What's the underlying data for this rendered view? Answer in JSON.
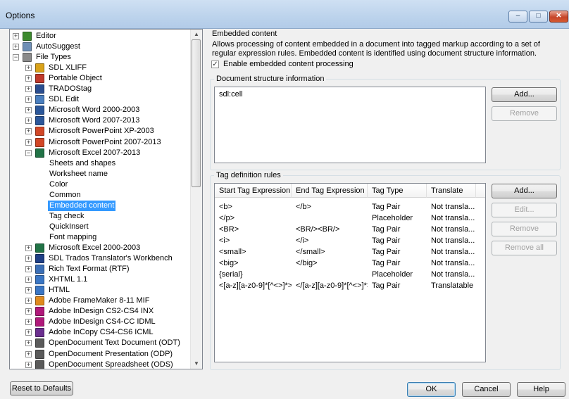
{
  "window": {
    "title": "Options",
    "minimize_glyph": "–",
    "maximize_glyph": "□",
    "close_glyph": "✕"
  },
  "tree": {
    "items": [
      {
        "label": "Editor",
        "icon": "editor-icon",
        "color": "#3c8a2e",
        "expander": "+"
      },
      {
        "label": "AutoSuggest",
        "icon": "autosuggest-icon",
        "color": "#6e8fb5",
        "expander": "+"
      },
      {
        "label": "File Types",
        "icon": "file-types-icon",
        "color": "#8a8a8a",
        "expander": "−"
      },
      {
        "label": "SDL XLIFF",
        "icon": "sdl-xliff-icon",
        "color": "#d9a21a",
        "expander": "+"
      },
      {
        "label": "Portable Object",
        "icon": "portable-object-icon",
        "color": "#c0392b",
        "expander": "+"
      },
      {
        "label": "TRADOStag",
        "icon": "tradostag-icon",
        "color": "#2a4d8f",
        "expander": "+"
      },
      {
        "label": "SDL Edit",
        "icon": "sdl-edit-icon",
        "color": "#4a7fbf",
        "expander": "+"
      },
      {
        "label": "Microsoft Word 2000-2003",
        "icon": "word-icon",
        "color": "#2b579a",
        "expander": "+"
      },
      {
        "label": "Microsoft Word 2007-2013",
        "icon": "word-icon",
        "color": "#2b579a",
        "expander": "+"
      },
      {
        "label": "Microsoft PowerPoint XP-2003",
        "icon": "powerpoint-icon",
        "color": "#d24726",
        "expander": "+"
      },
      {
        "label": "Microsoft PowerPoint 2007-2013",
        "icon": "powerpoint-icon",
        "color": "#d24726",
        "expander": "+"
      },
      {
        "label": "Microsoft Excel 2007-2013",
        "icon": "excel-icon",
        "color": "#217346",
        "expander": "−"
      },
      {
        "label": "Sheets and shapes",
        "icon": "",
        "color": "",
        "expander": ""
      },
      {
        "label": "Worksheet name",
        "icon": "",
        "color": "",
        "expander": ""
      },
      {
        "label": "Color",
        "icon": "",
        "color": "",
        "expander": ""
      },
      {
        "label": "Common",
        "icon": "",
        "color": "",
        "expander": ""
      },
      {
        "label": "Embedded content",
        "icon": "",
        "color": "",
        "expander": ""
      },
      {
        "label": "Tag check",
        "icon": "",
        "color": "",
        "expander": ""
      },
      {
        "label": "QuickInsert",
        "icon": "",
        "color": "",
        "expander": ""
      },
      {
        "label": "Font mapping",
        "icon": "",
        "color": "",
        "expander": ""
      },
      {
        "label": "Microsoft Excel 2000-2003",
        "icon": "excel-icon",
        "color": "#217346",
        "expander": "+"
      },
      {
        "label": "SDL Trados Translator's Workbench",
        "icon": "workbench-icon",
        "color": "#1f3f86",
        "expander": "+"
      },
      {
        "label": "Rich Text Format (RTF)",
        "icon": "rtf-icon",
        "color": "#3b6fb6",
        "expander": "+"
      },
      {
        "label": "XHTML 1.1",
        "icon": "xhtml-icon",
        "color": "#3a76c4",
        "expander": "+"
      },
      {
        "label": "HTML",
        "icon": "html-icon",
        "color": "#3a76c4",
        "expander": "+"
      },
      {
        "label": "Adobe FrameMaker 8-11 MIF",
        "icon": "framemaker-icon",
        "color": "#e08a1e",
        "expander": "+"
      },
      {
        "label": "Adobe InDesign CS2-CS4 INX",
        "icon": "indesign-icon",
        "color": "#b0187a",
        "expander": "+"
      },
      {
        "label": "Adobe InDesign CS4-CC IDML",
        "icon": "indesign-icon",
        "color": "#b0187a",
        "expander": "+"
      },
      {
        "label": "Adobe InCopy CS4-CS6 ICML",
        "icon": "incopy-icon",
        "color": "#6b2f8f",
        "expander": "+"
      },
      {
        "label": "OpenDocument Text Document (ODT)",
        "icon": "odt-icon",
        "color": "#5a5a5a",
        "expander": "+"
      },
      {
        "label": "OpenDocument Presentation (ODP)",
        "icon": "odp-icon",
        "color": "#5a5a5a",
        "expander": "+"
      },
      {
        "label": "OpenDocument Spreadsheet (ODS)",
        "icon": "ods-icon",
        "color": "#5a5a5a",
        "expander": "+"
      }
    ],
    "selected": "Embedded content",
    "scroll_up": "▲",
    "scroll_down": "▼"
  },
  "embedded": {
    "heading": "Embedded content",
    "description": "Allows processing of content embedded in a document into tagged markup according to a set of regular expression rules. Embedded content is identified using document structure information.",
    "enable_label": "Enable embedded content processing",
    "enable_checked": "✓"
  },
  "structure": {
    "title": "Document structure information",
    "items": [
      "sdl:cell"
    ],
    "add_label": "Add...",
    "remove_label": "Remove"
  },
  "rules": {
    "title": "Tag definition rules",
    "columns": [
      "Start Tag Expression",
      "End Tag Expression",
      "Tag Type",
      "Translate"
    ],
    "rows": [
      [
        "<b>",
        "</b>",
        "Tag Pair",
        "Not transla..."
      ],
      [
        "</p>",
        "",
        "Placeholder",
        "Not transla..."
      ],
      [
        "<BR>",
        "<BR/><BR/>",
        "Tag Pair",
        "Not transla..."
      ],
      [
        "<i>",
        "</i>",
        "Tag Pair",
        "Not transla..."
      ],
      [
        "<small>",
        "</small>",
        "Tag Pair",
        "Not transla..."
      ],
      [
        "<big>",
        "</big>",
        "Tag Pair",
        "Not transla..."
      ],
      [
        "{serial}",
        "",
        "Placeholder",
        "Not transla..."
      ],
      [
        "<[a-z][a-z0-9]*[^<>]*>",
        "</[a-z][a-z0-9]*[^<>]*>",
        "Tag Pair",
        "Translatable"
      ]
    ],
    "add_label": "Add...",
    "edit_label": "Edit...",
    "remove_label": "Remove",
    "remove_all_label": "Remove all"
  },
  "footer": {
    "reset_label": "Reset to Defaults",
    "ok_label": "OK",
    "cancel_label": "Cancel",
    "help_label": "Help"
  }
}
